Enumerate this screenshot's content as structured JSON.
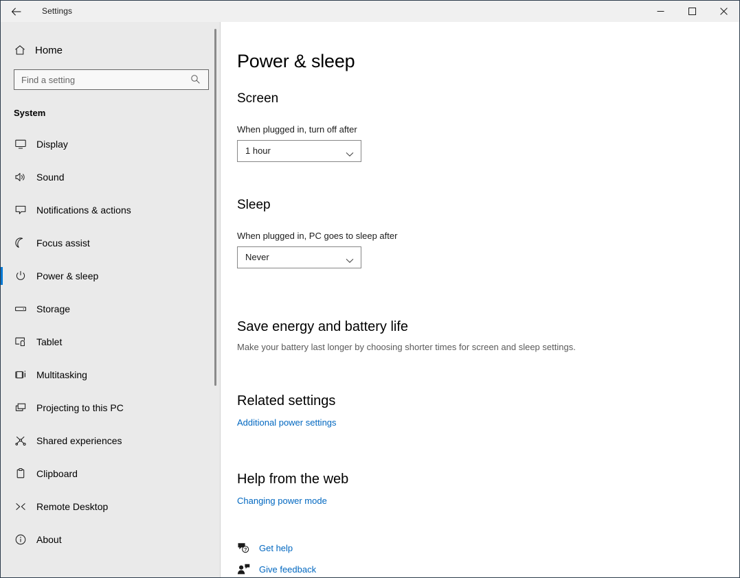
{
  "window": {
    "app_title": "Settings",
    "back_icon": "back-arrow-icon",
    "caption": {
      "minimize": "minimize-icon",
      "maximize": "maximize-icon",
      "close": "close-icon"
    }
  },
  "sidebar": {
    "home": {
      "label": "Home",
      "icon": "home-icon"
    },
    "search": {
      "placeholder": "Find a setting",
      "value": "",
      "icon": "search-icon"
    },
    "category": "System",
    "items": [
      {
        "label": "Display",
        "icon": "monitor-icon",
        "selected": false
      },
      {
        "label": "Sound",
        "icon": "speaker-icon",
        "selected": false
      },
      {
        "label": "Notifications & actions",
        "icon": "notification-icon",
        "selected": false
      },
      {
        "label": "Focus assist",
        "icon": "moon-icon",
        "selected": false
      },
      {
        "label": "Power & sleep",
        "icon": "power-icon",
        "selected": true
      },
      {
        "label": "Storage",
        "icon": "drive-icon",
        "selected": false
      },
      {
        "label": "Tablet",
        "icon": "tablet-icon",
        "selected": false
      },
      {
        "label": "Multitasking",
        "icon": "multitasking-icon",
        "selected": false
      },
      {
        "label": "Projecting to this PC",
        "icon": "project-screen-icon",
        "selected": false
      },
      {
        "label": "Shared experiences",
        "icon": "share-nodes-icon",
        "selected": false
      },
      {
        "label": "Clipboard",
        "icon": "clipboard-icon",
        "selected": false
      },
      {
        "label": "Remote Desktop",
        "icon": "remote-desktop-icon",
        "selected": false
      },
      {
        "label": "About",
        "icon": "info-icon",
        "selected": false
      }
    ]
  },
  "main": {
    "page_title": "Power & sleep",
    "screen": {
      "heading": "Screen",
      "field_label": "When plugged in, turn off after",
      "dropdown_value": "1 hour"
    },
    "sleep": {
      "heading": "Sleep",
      "field_label": "When plugged in, PC goes to sleep after",
      "dropdown_value": "Never"
    },
    "save_energy": {
      "heading": "Save energy and battery life",
      "description": "Make your battery last longer by choosing shorter times for screen and sleep settings."
    },
    "related_settings": {
      "heading": "Related settings",
      "link": "Additional power settings"
    },
    "help_from_web": {
      "heading": "Help from the web",
      "link": "Changing power mode"
    },
    "footer_links": [
      {
        "label": "Get help",
        "icon": "get-help-icon"
      },
      {
        "label": "Give feedback",
        "icon": "give-feedback-icon"
      }
    ]
  },
  "colors": {
    "accent": "#0078d4",
    "link": "#0067c0",
    "sidebar_bg": "#eaeaea",
    "content_bg": "#ffffff"
  }
}
